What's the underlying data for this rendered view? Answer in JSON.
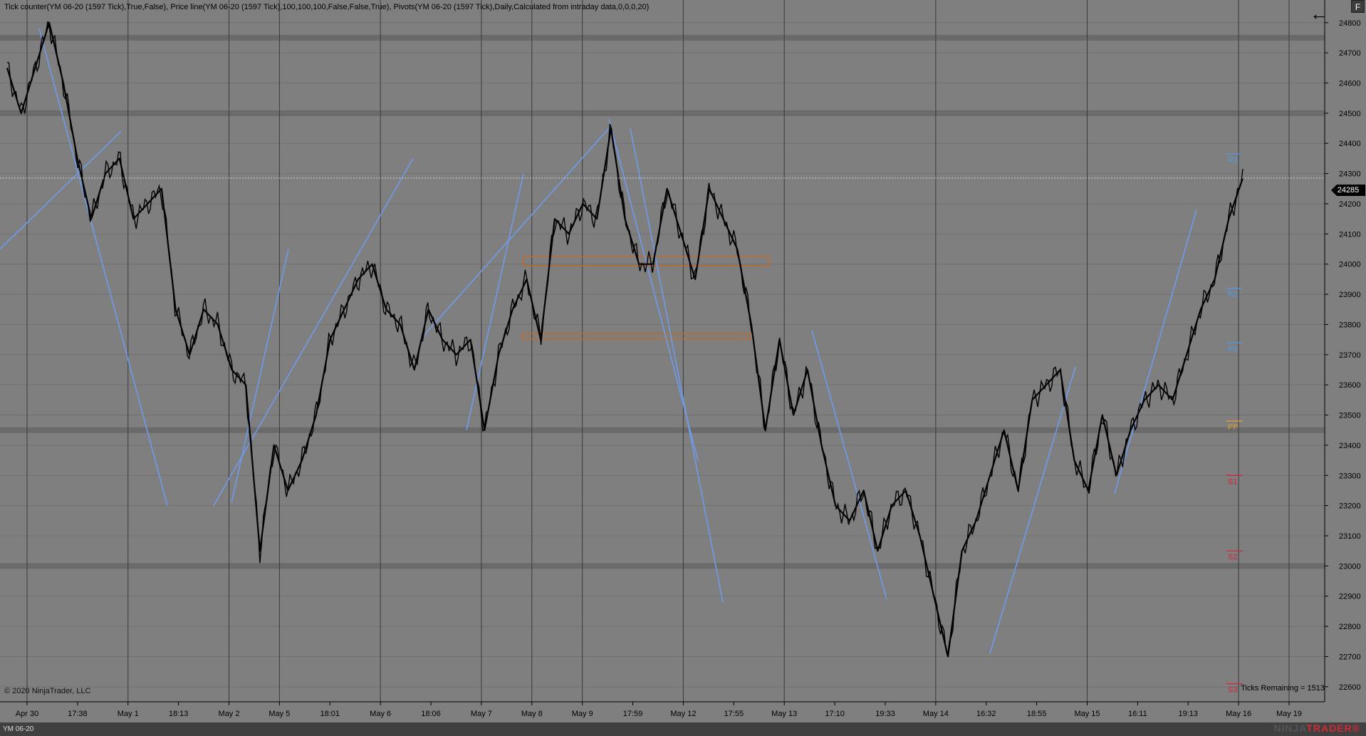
{
  "header": {
    "indicators_text": "Tick counter(YM 06-20 (1597 Tick),True,False), Price line(YM 06-20 (1597 Tick),100,100,100,False,False,True), Pivots(YM 06-20 (1597 Tick),Daily,Calculated from intraday data,0,0,0,20)"
  },
  "toolbar": {
    "f_label": "F",
    "back_icon": "arrow-left-icon"
  },
  "copyright": "© 2020 NinjaTrader, LLC",
  "ticks_remaining": "Ticks Remaining = 1513",
  "instrument": "YM 06-20",
  "logo": {
    "prefix": "NINJA",
    "brand": "TRADER",
    "mark": "®"
  },
  "colors": {
    "background": "#7f7f7f",
    "price_line": "#000000",
    "trendline": "#6f9be8",
    "resistance": "#4d9be0",
    "pivot_pp": "#e0a030",
    "support": "#d81f3a",
    "zone": "#c06a2a",
    "grid": "#000000"
  },
  "chart_data": {
    "type": "line",
    "title": "",
    "series": [
      {
        "values": [
          24650,
          24500,
          24650,
          24800,
          24600,
          24350,
          24150,
          24300,
          24350,
          24150,
          24200,
          24250,
          23850,
          23700,
          23850,
          23800,
          23650,
          23600,
          23050,
          23400,
          23250,
          23350,
          23500,
          23750,
          23850,
          23950,
          24000,
          23850,
          23800,
          23650,
          23850,
          23750,
          23700,
          23750,
          23450,
          23700,
          23850,
          23950,
          23750,
          24150,
          24100,
          24200,
          24150,
          24450,
          24150,
          24000,
          24000,
          24250,
          24100,
          23950,
          24250,
          24150,
          24050,
          23800,
          23450,
          23750,
          23500,
          23650,
          23400,
          23200,
          23150,
          23250,
          23050,
          23200,
          23250,
          23100,
          22900,
          22700,
          23050,
          23150,
          23300,
          23450,
          23250,
          23550,
          23600,
          23650,
          23350,
          23250,
          23500,
          23300,
          23450,
          23550,
          23600,
          23550,
          23700,
          23850,
          23950,
          24150,
          24285
        ]
      }
    ],
    "ylim": [
      22550,
      24875
    ],
    "y_ticks": [
      24800,
      24700,
      24600,
      24500,
      24400,
      24300,
      24200,
      24100,
      24000,
      23900,
      23800,
      23700,
      23600,
      23500,
      23400,
      23300,
      23200,
      23100,
      23000,
      22900,
      22800,
      22700,
      22600
    ],
    "last_price": "24285",
    "x_tick_labels": [
      "Apr 30",
      "17:38",
      "May 1",
      "18:13",
      "May 2",
      "May 5",
      "18:01",
      "May 6",
      "18:06",
      "May 7",
      "May 8",
      "May 9",
      "17:59",
      "May 12",
      "17:55",
      "May 13",
      "17:10",
      "19:33",
      "May 14",
      "16:32",
      "18:55",
      "May 15",
      "16:11",
      "19:13",
      "May 16",
      "May 19"
    ],
    "pivots": [
      {
        "label": "R3",
        "value": 24365
      },
      {
        "label": "R2",
        "value": 23920
      },
      {
        "label": "R1",
        "value": 23740
      },
      {
        "label": "PP",
        "value": 23480
      },
      {
        "label": "S1",
        "value": 23300
      },
      {
        "label": "S2",
        "value": 23050
      },
      {
        "label": "S3",
        "value": 22610
      }
    ],
    "grid": true
  }
}
